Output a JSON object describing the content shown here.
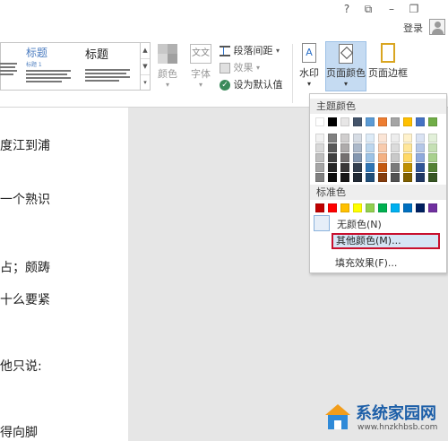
{
  "titlebar": {
    "help": "?",
    "ribbon_display": "⧉",
    "minimize": "–",
    "restore": "❐",
    "login_label": "登录"
  },
  "ribbon": {
    "styles": [
      {
        "title": "标题",
        "subtitle": "标题 1"
      },
      {
        "title": "标题",
        "subtitle": ""
      }
    ],
    "colors_label": "颜色",
    "fonts_label": "字体",
    "fonts_icon_text": "文文",
    "paragraph_spacing_label": "段落间距",
    "effects_label": "效果",
    "set_default_label": "设为默认值",
    "watermark_label": "水印",
    "page_color_label": "页面颜色",
    "page_borders_label": "页面边框"
  },
  "document": {
    "lines": [
      "度江到浦",
      "一个熟识",
      "占；颇踌",
      "十么要紧",
      "他只说:",
      "得向脚"
    ]
  },
  "page_color_menu": {
    "theme_colors_header": "主题颜色",
    "standard_colors_header": "标准色",
    "no_color_label": "无颜色(N)",
    "more_colors_label": "其他颜色(M)...",
    "fill_effects_label": "填充效果(F)...",
    "theme_top_row": [
      "#ffffff",
      "#000000",
      "#e7e6e6",
      "#44546a",
      "#5b9bd5",
      "#ed7d31",
      "#a5a5a5",
      "#ffc000",
      "#4472c4",
      "#70ad47"
    ],
    "theme_shades": [
      [
        "#f2f2f2",
        "#d9d9d9",
        "#bfbfbf",
        "#a6a6a6",
        "#808080"
      ],
      [
        "#808080",
        "#595959",
        "#404040",
        "#262626",
        "#0d0d0d"
      ],
      [
        "#d0cece",
        "#aeabab",
        "#757171",
        "#3a3838",
        "#171616"
      ],
      [
        "#d6dce4",
        "#acb9ca",
        "#8497b0",
        "#333f4f",
        "#222a35"
      ],
      [
        "#ddebf7",
        "#bdd7ee",
        "#9dc3e6",
        "#2e75b5",
        "#1f4e79"
      ],
      [
        "#fbe5d6",
        "#f8cbad",
        "#f4b183",
        "#c55a11",
        "#843c0c"
      ],
      [
        "#ededed",
        "#dbdbdb",
        "#c9c9c9",
        "#7b7b7b",
        "#525252"
      ],
      [
        "#fff2cc",
        "#ffe699",
        "#ffd966",
        "#bf9000",
        "#7f6000"
      ],
      [
        "#dae3f3",
        "#b4c7e7",
        "#8faadc",
        "#2f5597",
        "#203864"
      ],
      [
        "#e2f0d9",
        "#c5e0b4",
        "#a9d18e",
        "#548235",
        "#375623"
      ]
    ],
    "standard_colors": [
      "#c00000",
      "#ff0000",
      "#ffc000",
      "#ffff00",
      "#92d050",
      "#00b050",
      "#00b0f0",
      "#0070c0",
      "#002060",
      "#7030a0"
    ]
  },
  "watermark": {
    "site_name": "系统家园网",
    "site_url": "www.hnzkhbsb.com"
  }
}
